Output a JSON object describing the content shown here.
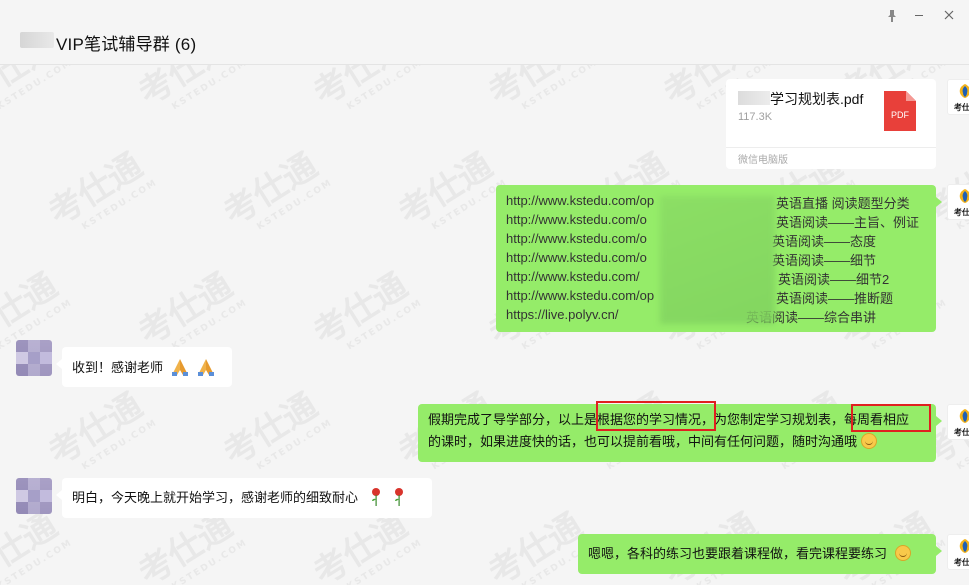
{
  "window": {
    "title": "VIP笔试辅导群 (6)",
    "pin_icon": "pin-icon",
    "minimize_icon": "minimize-icon",
    "close_icon": "close-icon"
  },
  "watermark": {
    "text": "考仕通",
    "sub": "KSTEDU.COM"
  },
  "messages": {
    "file": {
      "name": "学习规划表.pdf",
      "size": "117.3K",
      "source": "微信电脑版",
      "icon": "pdf-file-icon",
      "icon_label": "PDF"
    },
    "links": {
      "rows": [
        {
          "url": "http://www.kstedu.com/op",
          "desc": "英语直播 阅读题型分类"
        },
        {
          "url": "http://www.kstedu.com/o",
          "desc": "英语阅读——主旨、例证"
        },
        {
          "url": "http://www.kstedu.com/o",
          "desc": "英语阅读——态度"
        },
        {
          "url": "http://www.kstedu.com/o",
          "desc": "英语阅读——细节"
        },
        {
          "url": "http://www.kstedu.com/",
          "desc": "英语阅读——细节2"
        },
        {
          "url": "http://www.kstedu.com/op",
          "desc": "英语阅读——推断题"
        },
        {
          "url": "https://live.polyv.cn/",
          "desc": "英语阅读——综合串讲"
        }
      ]
    },
    "reply1": {
      "text": "收到！感谢老师"
    },
    "plan": {
      "line1_a": "假期完成了导学部分，以上是",
      "line1_b": "根据您的学习情况",
      "line1_c": "，为您制定学习规划表，",
      "line1_d": "每周看相应",
      "line2": "的课时，如果进度快的话，也可以提前看哦，中间有任何问题，随时沟通哦"
    },
    "reply2": {
      "text": "明白，今天晚上就开始学习，感谢老师的细致耐心"
    },
    "last": {
      "text": "嗯嗯，各科的练习也要跟着课程做，看完课程要练习"
    }
  },
  "teacher_avatar": {
    "label": "考仕通",
    "icon": "kstedu-logo-icon"
  },
  "colors": {
    "sent_bubble": "#95ec69",
    "received_bubble": "#ffffff",
    "background": "#f5f5f5",
    "highlight_box": "#e02020",
    "pdf_red": "#e8403a"
  }
}
